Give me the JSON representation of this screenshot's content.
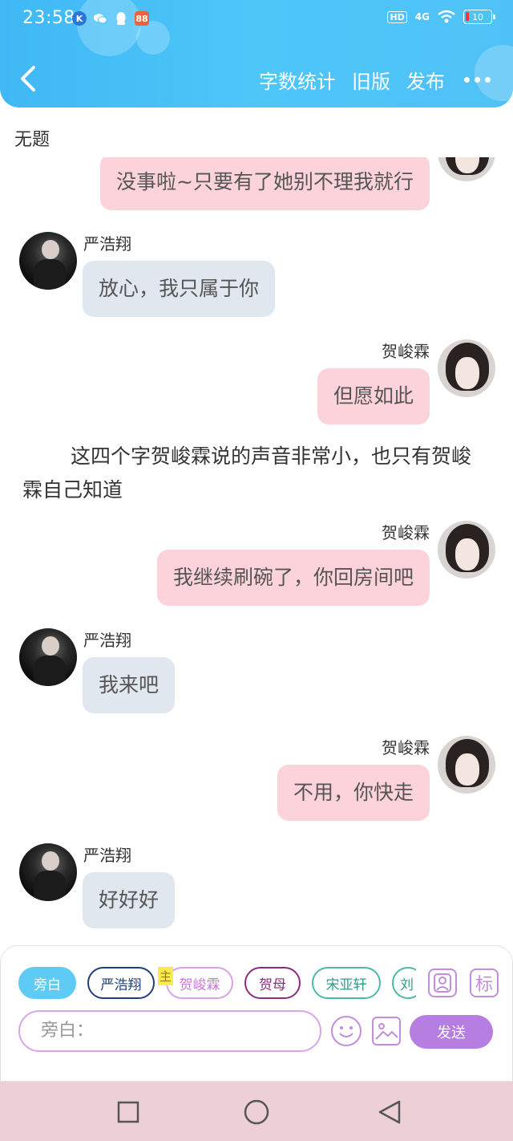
{
  "status_bar": {
    "time": "23:58",
    "network": "4G",
    "hd": "HD",
    "battery": "10"
  },
  "header": {
    "actions": [
      "字数统计",
      "旧版",
      "发布"
    ]
  },
  "document": {
    "title": "无题"
  },
  "messages": [
    {
      "side": "right",
      "speaker": "",
      "text": "没事啦~只要有了她别不理我就行"
    },
    {
      "side": "left",
      "speaker": "严浩翔",
      "text": "放心，我只属于你"
    },
    {
      "side": "right",
      "speaker": "贺峻霖",
      "text": "但愿如此"
    },
    {
      "side": "right",
      "speaker": "贺峻霖",
      "text": "我继续刷碗了，你回房间吧"
    },
    {
      "side": "left",
      "speaker": "严浩翔",
      "text": "我来吧"
    },
    {
      "side": "right",
      "speaker": "贺峻霖",
      "text": "不用，你快走"
    },
    {
      "side": "left",
      "speaker": "严浩翔",
      "text": "好好好"
    }
  ],
  "narration": "这四个字贺峻霖说的声音非常小，也只有贺峻霖自己知道",
  "compose": {
    "chips": [
      "旁白",
      "严浩翔",
      "贺峻霖",
      "贺母",
      "宋亚轩",
      "刘"
    ],
    "host_tag": "主",
    "tag_button": "标",
    "input_placeholder": "旁白：",
    "send_label": "发送"
  },
  "colors": {
    "header": "#4ec6f8",
    "pink_bubble": "#fdd3db",
    "gray_bubble": "#e1e7ee",
    "send": "#b57ee0",
    "navbar": "#ecd0d6"
  }
}
